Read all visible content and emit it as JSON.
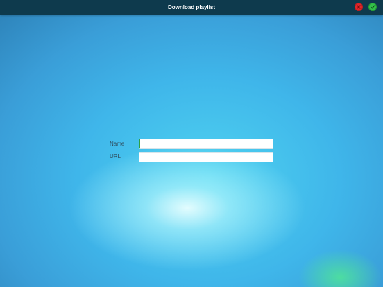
{
  "header": {
    "title": "Download playlist",
    "cancel_icon": "close-icon",
    "confirm_icon": "checkmark-icon"
  },
  "form": {
    "name_label": "Name",
    "name_value": "",
    "url_label": "URL",
    "url_value": ""
  },
  "colors": {
    "topbar": "#0e3a4d",
    "cancel": "#e0262a",
    "confirm": "#33c14a",
    "background": "#3fb6ea"
  }
}
